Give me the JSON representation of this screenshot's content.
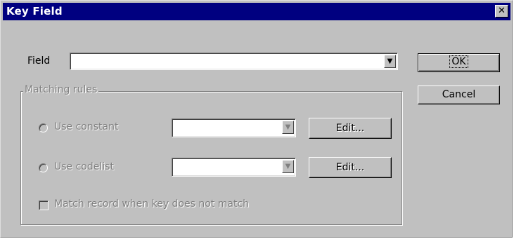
{
  "dialog": {
    "title": "Key Field",
    "close_glyph": "✕"
  },
  "field": {
    "label": "Field",
    "value": "",
    "dropdown_glyph": "▼"
  },
  "buttons": {
    "ok_label": "OK",
    "cancel_label": "Cancel"
  },
  "matching_rules": {
    "group_label": "Matching rules",
    "use_constant": {
      "label": "Use constant",
      "value": "",
      "edit_label": "Edit..."
    },
    "use_codelist": {
      "label": "Use codelist",
      "value": "",
      "edit_label": "Edit..."
    },
    "match_record_label": "Match record when key does not match"
  },
  "colors": {
    "title_bar": "#000080",
    "dialog_face": "#c0c0c0",
    "disabled_text": "#808080"
  }
}
